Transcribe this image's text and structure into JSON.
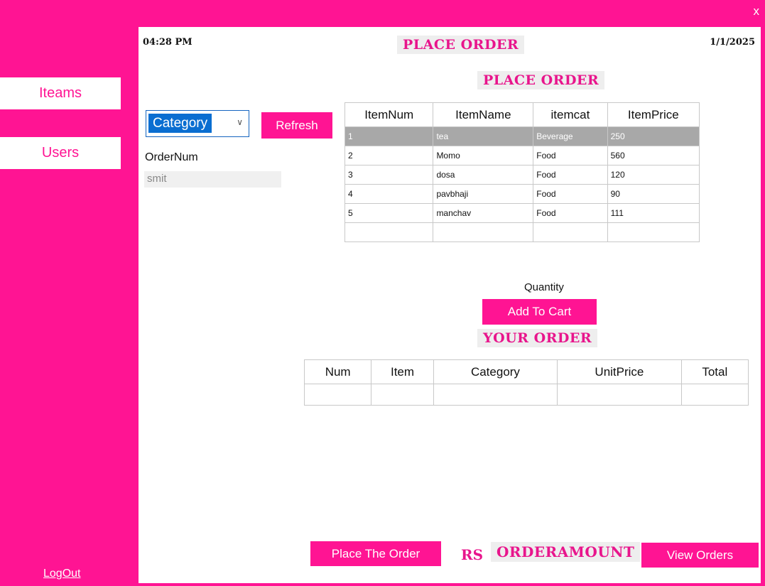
{
  "window": {
    "close_label": "x"
  },
  "sidebar": {
    "items": [
      {
        "label": "Iteams"
      },
      {
        "label": "Users"
      }
    ],
    "logout_label": "LogOut"
  },
  "header": {
    "time": "04:28 PM",
    "title": "PLACE ORDER",
    "date": "1/1/2025"
  },
  "items_section": {
    "title": "PLACE ORDER"
  },
  "filter": {
    "category_selected": "Category",
    "refresh_label": "Refresh"
  },
  "order_num": {
    "label": "OrderNum",
    "placeholder": "smit"
  },
  "items_table": {
    "columns": [
      "ItemNum",
      "ItemName",
      "itemcat",
      "ItemPrice"
    ],
    "rows": [
      [
        "1",
        "tea",
        "Beverage",
        "250"
      ],
      [
        "2",
        "Momo",
        "Food",
        "560"
      ],
      [
        "3",
        "dosa",
        "Food",
        "120"
      ],
      [
        "4",
        "pavbhaji",
        "Food",
        "90"
      ],
      [
        "5",
        "manchav",
        "Food",
        "111"
      ]
    ],
    "selected_row": 0
  },
  "quantity": {
    "label": "Quantity"
  },
  "cart": {
    "add_label": "Add To Cart"
  },
  "order_section": {
    "title": "YOUR ORDER",
    "columns": [
      "Num",
      "Item",
      "Category",
      "UnitPrice",
      "Total"
    ]
  },
  "footer": {
    "place_order_label": "Place The Order",
    "currency": "RS",
    "amount": "ORDERAMOUNT",
    "view_orders_label": "View Orders"
  },
  "colors": {
    "accent": "#ff1493",
    "title_text": "#e8158c",
    "selected_row": "#a8a8a8"
  }
}
